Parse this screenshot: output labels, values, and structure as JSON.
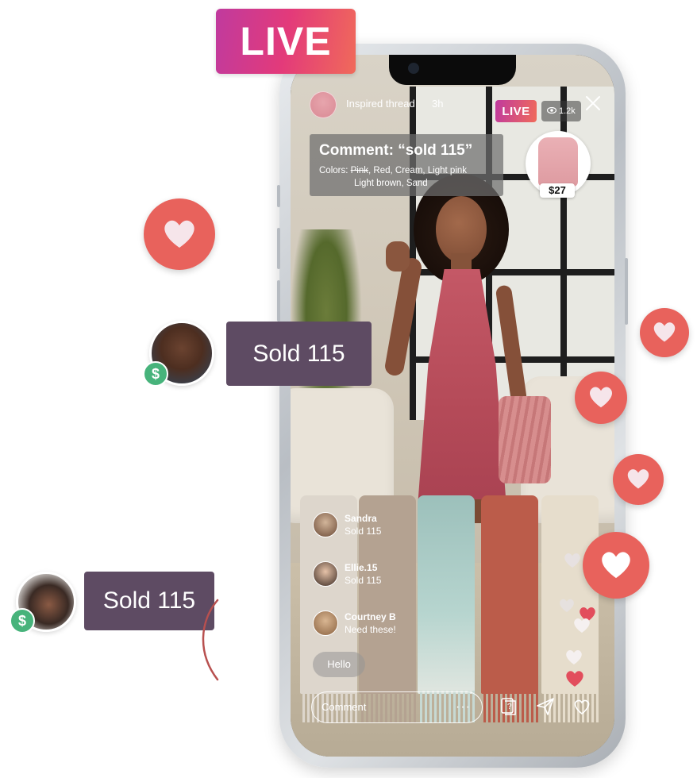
{
  "badge": {
    "live_label": "LIVE"
  },
  "stream": {
    "host_name": "Inspired thread",
    "elapsed": "3h",
    "live_label": "LIVE",
    "viewer_count": "1.2k"
  },
  "comment_prompt": {
    "title": "Comment: “sold 115”",
    "colors_prefix": "Colors:",
    "color_struck": "Pink",
    "colors_rest": ", Red, Cream, Light pink",
    "colors_line2": "Light brown, Sand"
  },
  "product": {
    "price": "$27"
  },
  "chat": [
    {
      "name": "Sandra",
      "message": "Sold 115"
    },
    {
      "name": "Ellie.15",
      "message": "Sold 115"
    },
    {
      "name": "Courtney B",
      "message": "Need these!"
    }
  ],
  "quick_reply": "Hello",
  "composer": {
    "placeholder": "Comment",
    "more": "···"
  },
  "sold_notifications": [
    {
      "label": "Sold 115"
    },
    {
      "label": "Sold 115"
    }
  ],
  "dollar_glyph": "$",
  "colors": {
    "accent_gradient_start": "#c03a9e",
    "accent_gradient_end": "#f06a5a",
    "heart_bubble": "#e8625c",
    "sold_pill": "#5e4b63",
    "paid_badge": "#47b37b"
  },
  "icons": {
    "close": "close-icon",
    "viewers": "eye-icon",
    "info": "question-card-icon",
    "share": "send-icon",
    "like": "heart-outline-icon"
  }
}
